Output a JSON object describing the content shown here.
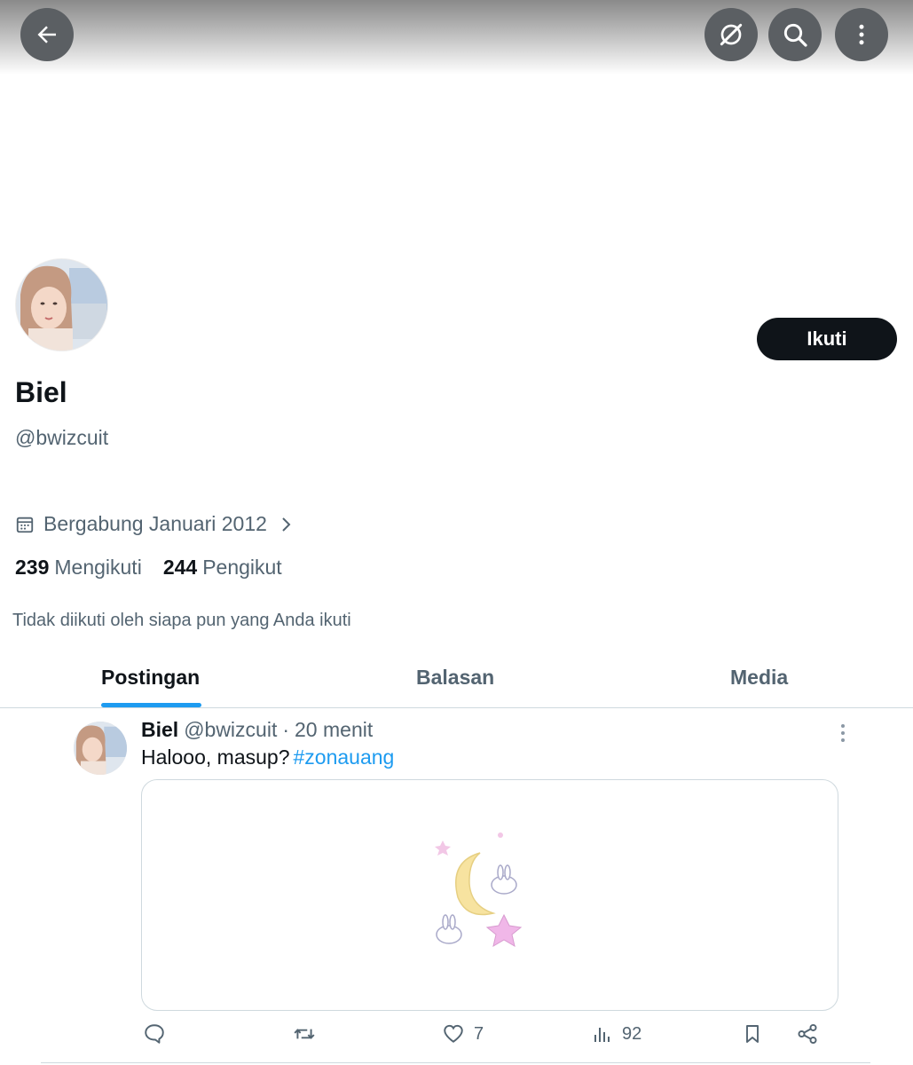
{
  "header": {
    "back_icon": "arrow-left-icon",
    "grok_icon": "grok-icon",
    "search_icon": "search-icon",
    "more_icon": "more-vertical-icon"
  },
  "profile": {
    "name": "Biel",
    "handle": "@bwizcuit",
    "follow_label": "Ikuti",
    "joined": "Bergabung Januari 2012",
    "following_count": "239",
    "following_label": "Mengikuti",
    "followers_count": "244",
    "followers_label": "Pengikut",
    "not_followed_text": "Tidak diikuti oleh siapa pun yang Anda ikuti"
  },
  "tabs": [
    {
      "label": "Postingan",
      "active": true
    },
    {
      "label": "Balasan",
      "active": false
    },
    {
      "label": "Media",
      "active": false
    }
  ],
  "post": {
    "name": "Biel",
    "handle": "@bwizcuit",
    "separator": "·",
    "time": "20 menit",
    "text": "Halooo, masup?",
    "hashtag": "#zonauang",
    "actions": {
      "reply_count": "",
      "repost_count": "",
      "like_count": "7",
      "views_count": "92"
    }
  },
  "colors": {
    "accent": "#1d9bf0",
    "text_primary": "#0f1419",
    "text_secondary": "#536471",
    "button_dark": "#0f1419"
  }
}
